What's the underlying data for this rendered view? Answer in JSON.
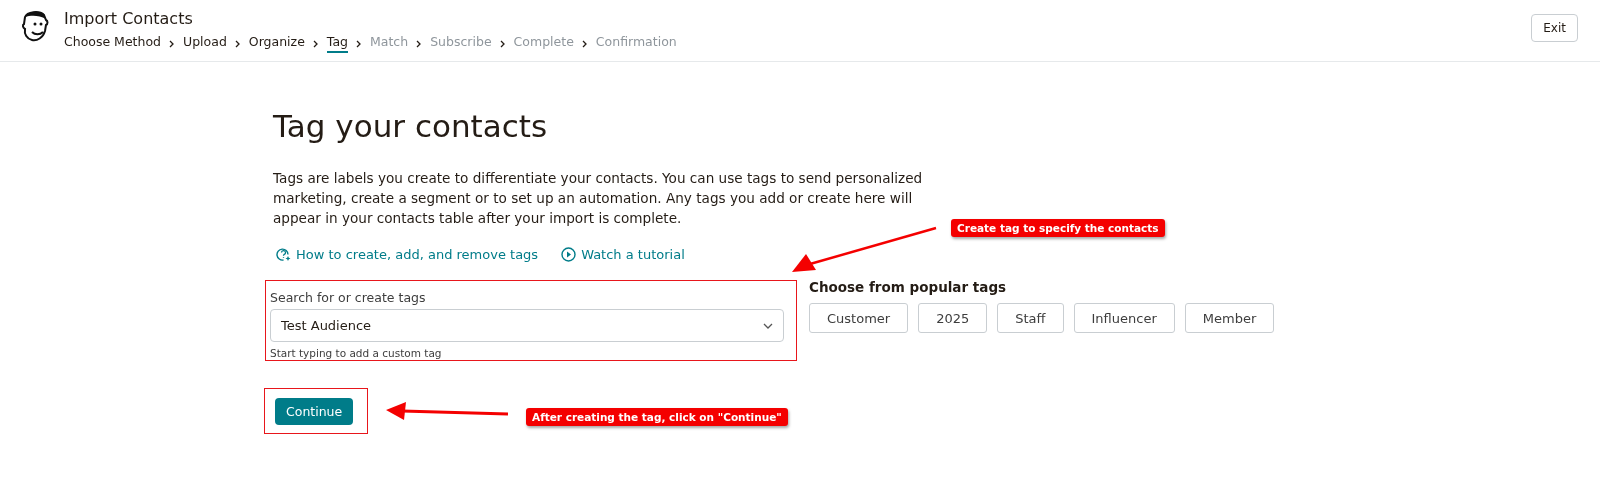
{
  "header": {
    "title": "Import Contacts",
    "steps": [
      {
        "label": "Choose Method",
        "kind": "done"
      },
      {
        "label": "Upload",
        "kind": "done"
      },
      {
        "label": "Organize",
        "kind": "done"
      },
      {
        "label": "Tag",
        "kind": "current"
      },
      {
        "label": "Match",
        "kind": "upcoming"
      },
      {
        "label": "Subscribe",
        "kind": "upcoming"
      },
      {
        "label": "Complete",
        "kind": "upcoming"
      },
      {
        "label": "Confirmation",
        "kind": "upcoming"
      }
    ],
    "exit": "Exit"
  },
  "main": {
    "heading": "Tag your contacts",
    "description": "Tags are labels you create to differentiate your contacts. You can use tags to send personalized marketing, create a segment or to set up an automation. Any tags you add or create here will appear in your contacts table after your import is complete.",
    "links": [
      {
        "label": "How to create, add, and remove tags",
        "kind": "help"
      },
      {
        "label": "Watch a tutorial",
        "kind": "video"
      }
    ],
    "tag_field": {
      "label": "Search for or create tags",
      "value": "Test Audience",
      "hint": "Start typing to add a custom tag"
    },
    "popular": {
      "title": "Choose from popular tags",
      "tags": [
        "Customer",
        "2025",
        "Staff",
        "Influencer",
        "Member"
      ]
    },
    "continue": "Continue"
  },
  "annotations": [
    "Create tag to specify the contacts",
    "After creating the tag, click on \"Continue\""
  ]
}
